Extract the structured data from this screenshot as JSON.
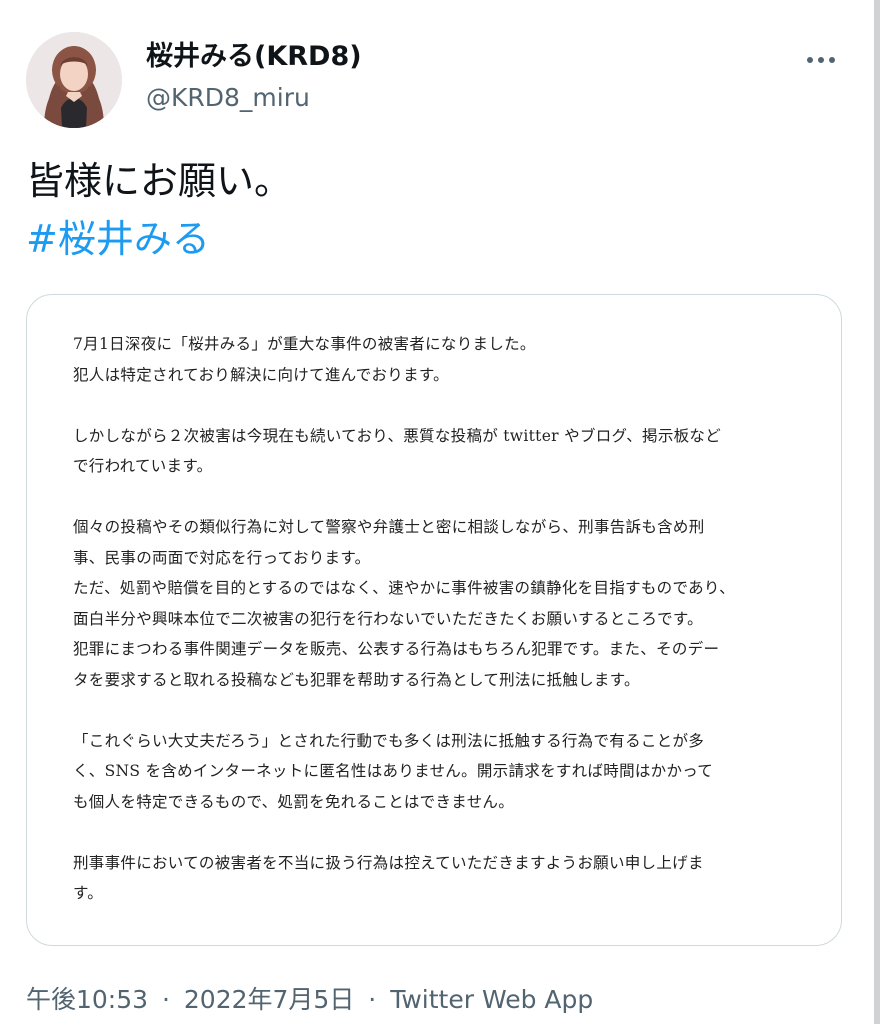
{
  "author": {
    "display_name": "桜井みる(KRD8)",
    "username": "@KRD8_miru",
    "more_label": "•••"
  },
  "tweet": {
    "text_line1": "皆様にお願い。",
    "hashtag": "#桜井みる"
  },
  "statement": {
    "p1_l1": "7月1日深夜に「桜井みる」が重大な事件の被害者になりました。",
    "p1_l2": "犯人は特定されており解決に向けて進んでおります。",
    "p2_l1": "しかしながら２次被害は今現在も続いており、悪質な投稿が twitter やブログ、掲示板など",
    "p2_l2": "で行われています。",
    "p3_l1": "個々の投稿やその類似行為に対して警察や弁護士と密に相談しながら、刑事告訴も含め刑",
    "p3_l2": "事、民事の両面で対応を行っております。",
    "p3_l3": "ただ、処罰や賠償を目的とするのではなく、速やかに事件被害の鎮静化を目指すものであり、",
    "p3_l4": "面白半分や興味本位で二次被害の犯行を行わないでいただきたくお願いするところです。",
    "p3_l5": "犯罪にまつわる事件関連データを販売、公表する行為はもちろん犯罪です。また、そのデー",
    "p3_l6": "タを要求すると取れる投稿なども犯罪を帮助する行為として刑法に抵触します。",
    "p4_l1": "「これぐらい大丈夫だろう」とされた行動でも多くは刑法に抵触する行為で有ることが多",
    "p4_l2": "く、SNS を含めインターネットに匿名性はありません。開示請求をすれば時間はかかって",
    "p4_l3": "も個人を特定できるもので、処罰を免れることはできません。",
    "p5_l1": "刑事事件においての被害者を不当に扱う行為は控えていただきますようお願い申し上げま",
    "p5_l2": "す。"
  },
  "footer": {
    "time": "午後10:53",
    "date": "2022年7月5日",
    "separator": "·",
    "source": "Twitter Web App"
  },
  "colors": {
    "hashtag": "#1d9bf0",
    "secondary_text": "#536471",
    "card_border": "#cfd9de"
  },
  "icons": {
    "more": "more-horizontal-icon",
    "avatar": "user-avatar"
  }
}
